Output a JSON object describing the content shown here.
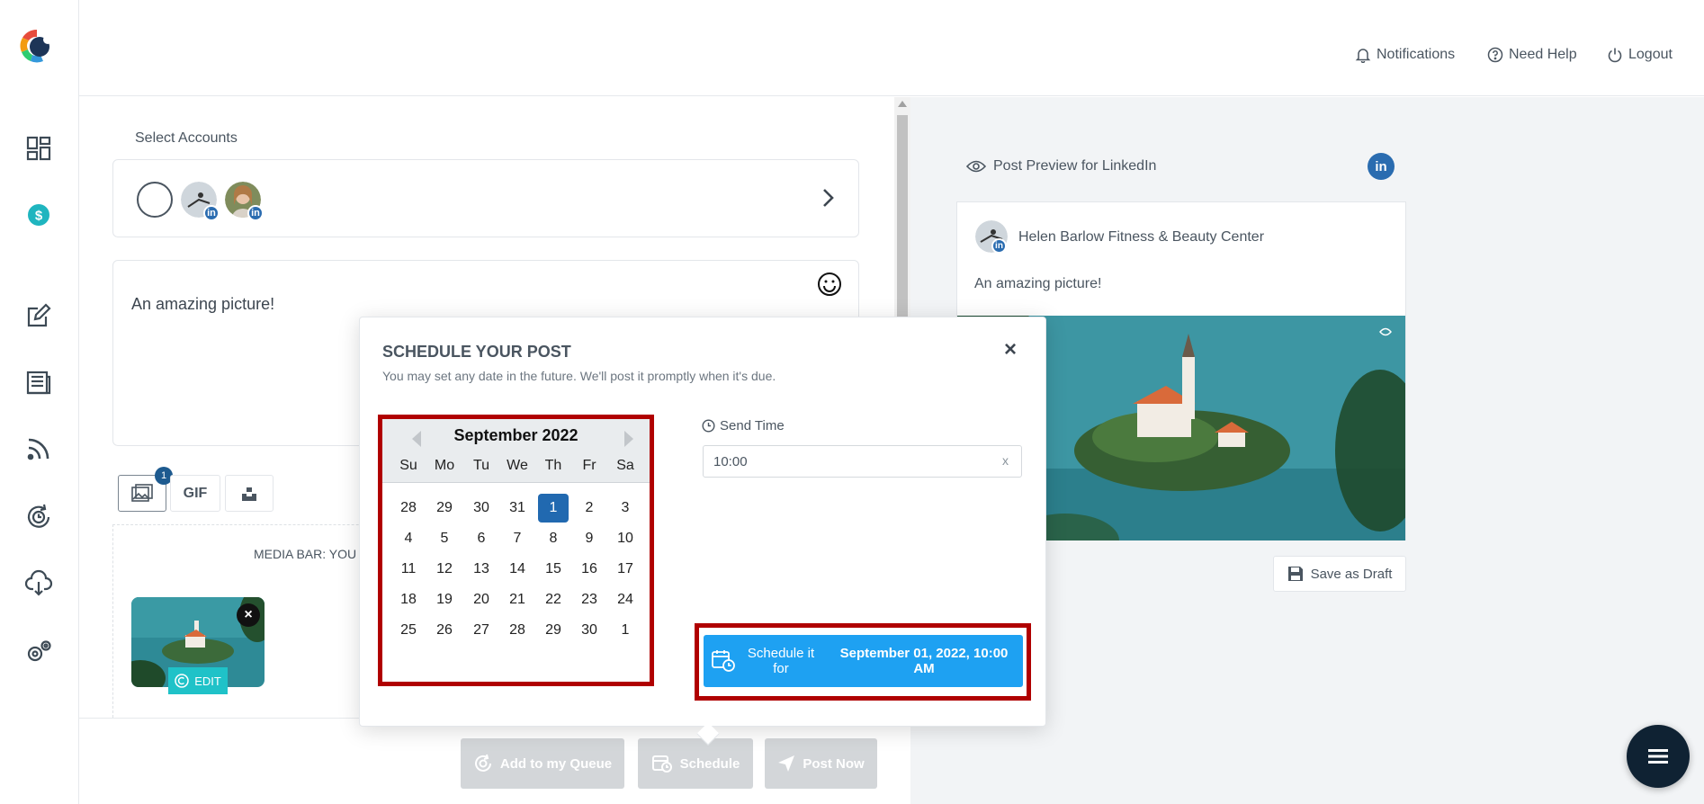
{
  "header": {
    "notifications": "Notifications",
    "need_help": "Need Help",
    "logout": "Logout"
  },
  "sidebar": {
    "items": [
      "dashboard-icon",
      "dollar-icon",
      "edit-icon",
      "news-icon",
      "rss-icon",
      "refresh-clock-icon",
      "cloud-download-icon",
      "settings-icon"
    ]
  },
  "composer": {
    "select_accounts": "Select Accounts",
    "post_text": "An amazing picture!",
    "media_count": "1",
    "gif_label": "GIF",
    "media_bar_label": "MEDIA BAR: YOU",
    "edit_label": "EDIT"
  },
  "actions": {
    "add_to_queue": "Add to my Queue",
    "schedule": "Schedule",
    "post_now": "Post Now"
  },
  "preview": {
    "title": "Post Preview for LinkedIn",
    "account_name": "Helen Barlow Fitness & Beauty Center",
    "text": "An amazing picture!",
    "save_draft": "Save as Draft",
    "linkedin_badge": "in"
  },
  "modal": {
    "title": "SCHEDULE YOUR POST",
    "subtitle": "You may set any date in the future. We'll post it promptly when it's due.",
    "close": "×",
    "calendar": {
      "month": "September 2022",
      "days_of_week": [
        "Su",
        "Mo",
        "Tu",
        "We",
        "Th",
        "Fr",
        "Sa"
      ],
      "weeks": [
        [
          "28",
          "29",
          "30",
          "31",
          "1",
          "2",
          "3"
        ],
        [
          "4",
          "5",
          "6",
          "7",
          "8",
          "9",
          "10"
        ],
        [
          "11",
          "12",
          "13",
          "14",
          "15",
          "16",
          "17"
        ],
        [
          "18",
          "19",
          "20",
          "21",
          "22",
          "23",
          "24"
        ],
        [
          "25",
          "26",
          "27",
          "28",
          "29",
          "30",
          "1"
        ]
      ],
      "selected": "1"
    },
    "send_time_label": "Send Time",
    "send_time_value": "10:00",
    "clear": "x",
    "schedule_left": "Schedule it for",
    "schedule_right": "September 01, 2022, 10:00 AM"
  },
  "colors": {
    "accent": "#1ea1f2",
    "selected_day": "#2169b0",
    "highlight_frame": "#b00000",
    "linkedin": "#2a6cb0"
  }
}
